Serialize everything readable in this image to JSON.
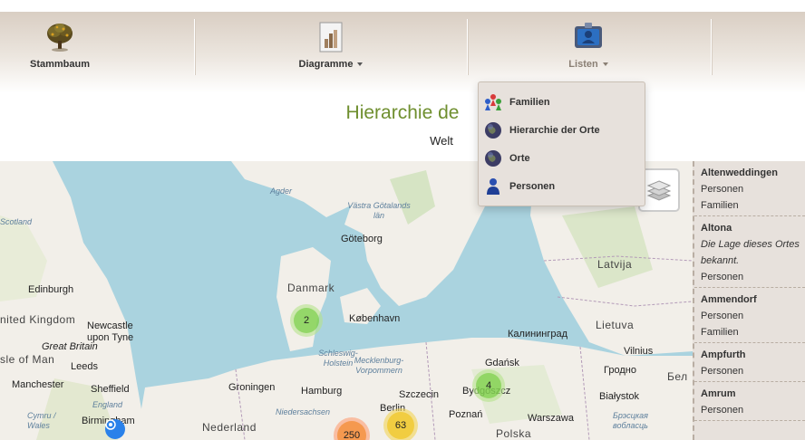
{
  "nav": {
    "items": [
      {
        "label": "Stammbaum",
        "icon": "tree-icon"
      },
      {
        "label": "Diagramme",
        "icon": "bar-chart-document-icon"
      },
      {
        "label": "Listen",
        "icon": "id-card-icon"
      }
    ]
  },
  "page": {
    "title": "Hierarchie der Orte",
    "title_visible": "Hierarchie de",
    "subtitle": "Welt"
  },
  "dropdown": {
    "items": [
      {
        "label": "Familien",
        "icon": "family-icon"
      },
      {
        "label": "Hierarchie der Orte",
        "icon": "globe-icon"
      },
      {
        "label": "Orte",
        "icon": "globe-icon"
      },
      {
        "label": "Personen",
        "icon": "person-icon"
      }
    ]
  },
  "map": {
    "labels": {
      "agder": "Agder",
      "vastra": "Västra Götalands län",
      "goteborg": "Göteborg",
      "scotland": "Scotland",
      "danmark": "Danmark",
      "edinburgh": "Edinburgh",
      "kobenhavn": "København",
      "latvija": "Latvija",
      "united_kingdom": "nited Kingdom",
      "newcastle": "Newcastle upon Tyne",
      "great_britain": "Great Britain",
      "isle_of_man": "sle of Man",
      "leeds": "Leeds",
      "schleswig": "Schleswig-Holstein",
      "mecklenburg": "Mecklenburg-Vorpommern",
      "kaliningrad": "Калининград",
      "lietuva": "Lietuva",
      "vilnius": "Vilnius",
      "gdansk": "Gdańsk",
      "manchester": "Manchester",
      "sheffield": "Sheffield",
      "england": "England",
      "groningen": "Groningen",
      "hamburg": "Hamburg",
      "szczecin": "Szczecin",
      "bydgoszcz": "Bydgoszcz",
      "grodno": "Гродно",
      "bialystok": "Białystok",
      "birmingham": "Birmingham",
      "cymru": "Cymru / Wales",
      "niedersachsen": "Niedersachsen",
      "berlin": "Berlin",
      "poznan": "Poznań",
      "warszawa": "Warszawa",
      "brest": "Брэсцкая вобласць",
      "nederland": "Nederland",
      "polska": "Polska",
      "belarus": "Бел"
    },
    "clusters": [
      {
        "count": "2",
        "color": "#b5e28c"
      },
      {
        "count": "4",
        "color": "#b5e28c"
      },
      {
        "count": "63",
        "color": "#f1d357"
      },
      {
        "count": "250",
        "color": "#fd9c73"
      }
    ]
  },
  "sidebar": {
    "entries": [
      {
        "name": "Altenweddingen",
        "links": [
          "Personen",
          "Familien"
        ]
      },
      {
        "name": "Altona",
        "note": "Die Lage dieses Ortes ist nicht bekannt.",
        "note_line1": "Die Lage dieses Ortes",
        "note_line2": "bekannt.",
        "links": [
          "Personen"
        ]
      },
      {
        "name": "Ammendorf",
        "links": [
          "Personen",
          "Familien"
        ]
      },
      {
        "name": "Ampfurth",
        "links": [
          "Personen"
        ]
      },
      {
        "name": "Amrum",
        "links": [
          "Personen"
        ]
      }
    ]
  },
  "colors": {
    "title": "#6f8f2f",
    "navbar_top": "#d9cec3",
    "sidebar_bg": "#e7e1dc",
    "sea": "#aad3df",
    "land": "#f2efe9"
  }
}
